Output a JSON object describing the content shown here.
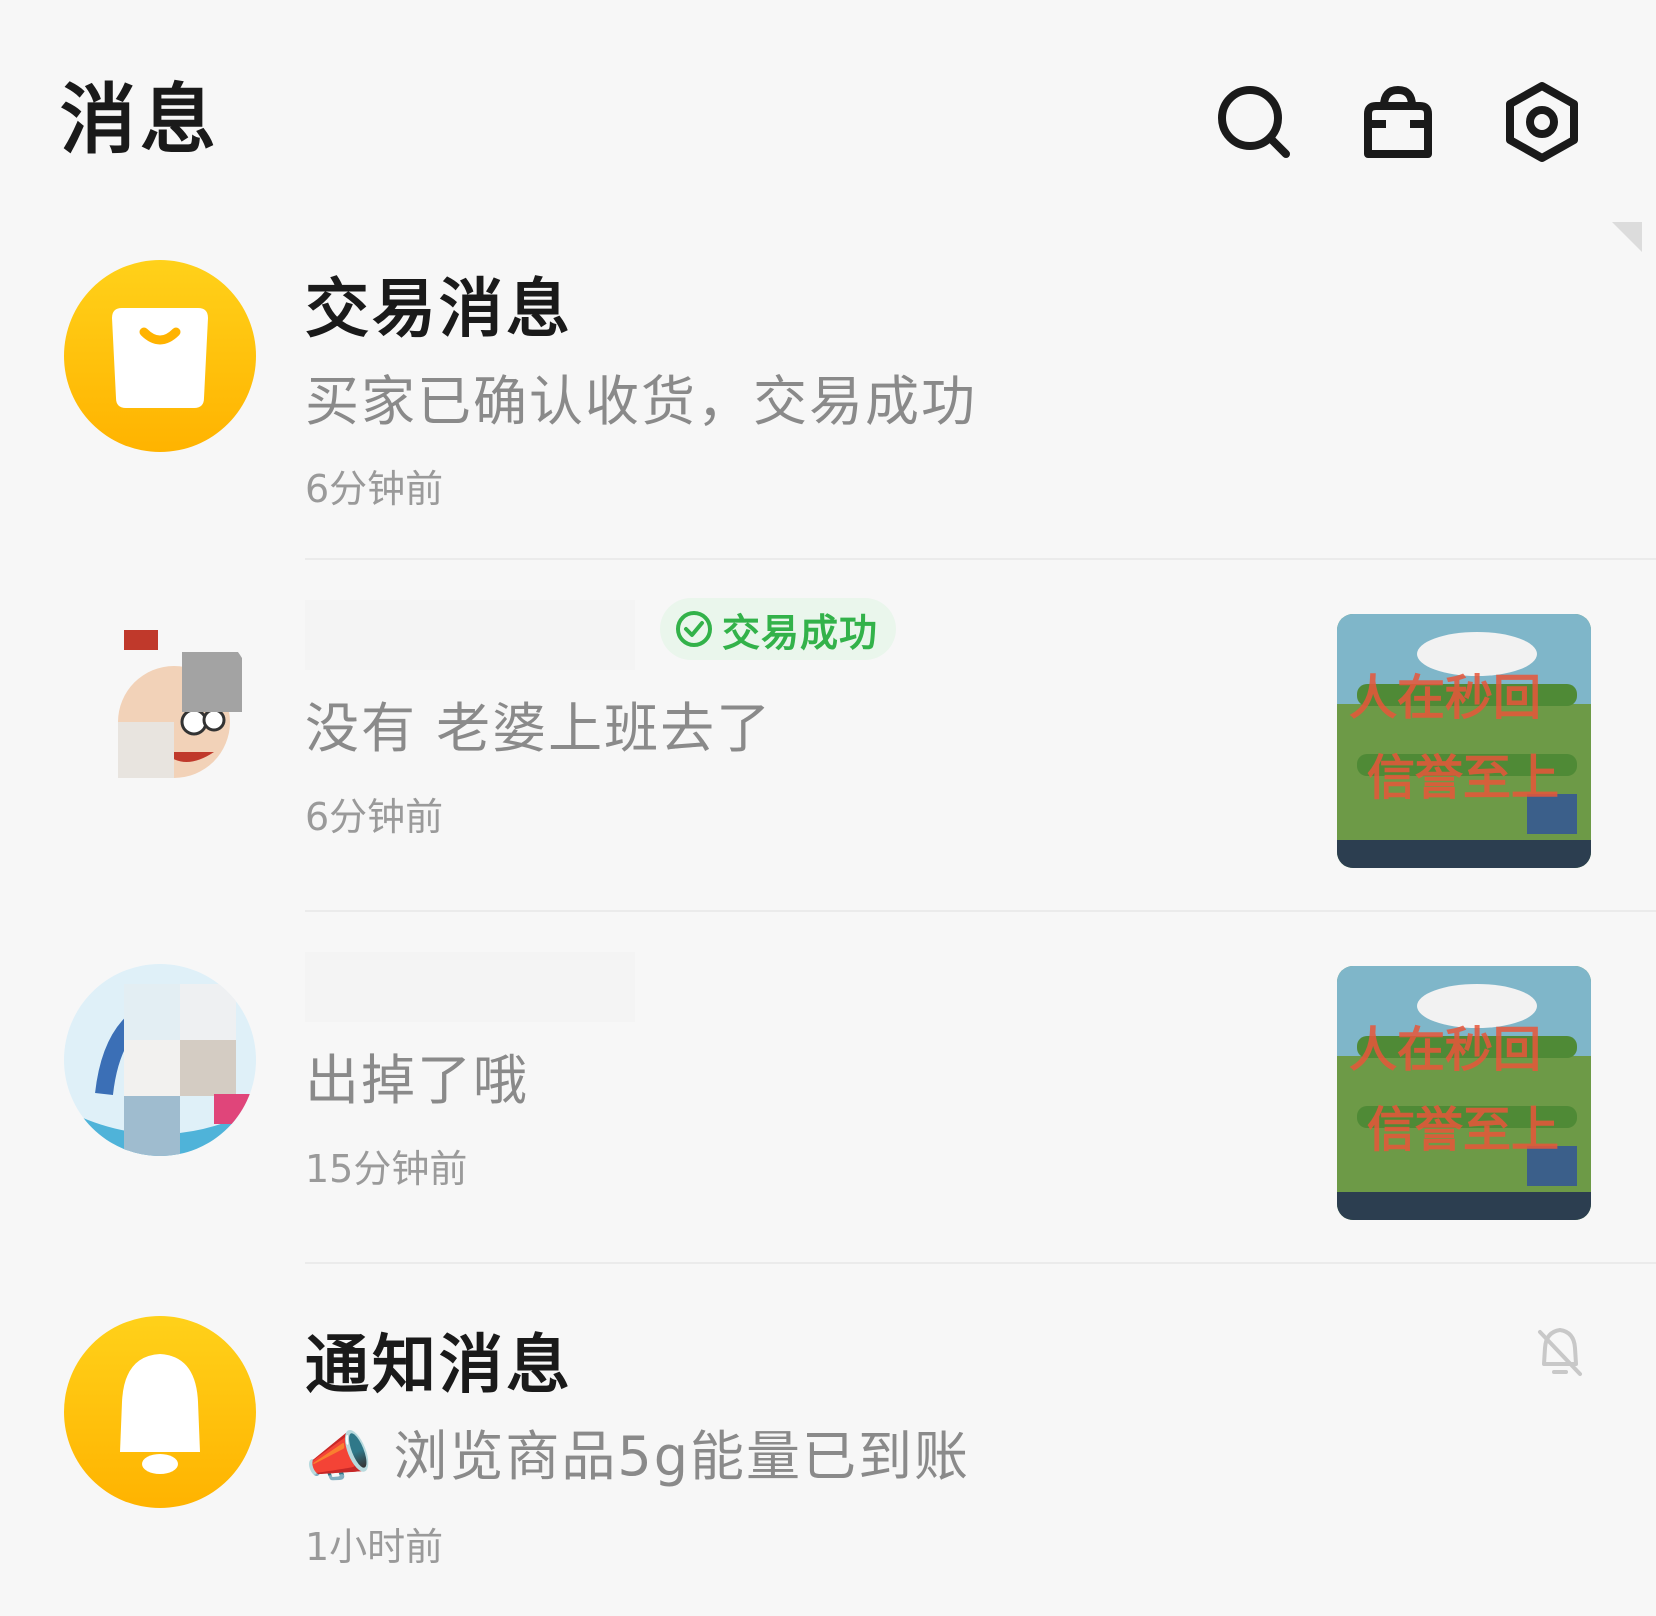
{
  "header": {
    "title": "消息",
    "icons": [
      "search-icon",
      "bag-icon",
      "settings-icon"
    ]
  },
  "messages": [
    {
      "title": "交易消息",
      "preview": "买家已确认收货，交易成功",
      "time": "6分钟前",
      "avatar": "shopping-bag-icon"
    },
    {
      "title": "",
      "badge": "交易成功",
      "preview": "没有 老婆上班去了",
      "time": "6分钟前",
      "avatar": "user-avatar",
      "thumbnail_text": [
        "人在秒回",
        "信誉至上"
      ]
    },
    {
      "title": "",
      "preview": "出掉了哦",
      "time": "15分钟前",
      "avatar": "user-avatar",
      "thumbnail_text": [
        "人在秒回",
        "信誉至上"
      ]
    },
    {
      "title": "通知消息",
      "preview_icon": "📣",
      "preview": "浏览商品5g能量已到账",
      "time": "1小时前",
      "avatar": "bell-icon",
      "status_icon": "mute-bell-icon"
    }
  ],
  "colors": {
    "accent_yellow": "#ffc107",
    "success_green": "#33b24a",
    "background": "#f7f7f7"
  }
}
